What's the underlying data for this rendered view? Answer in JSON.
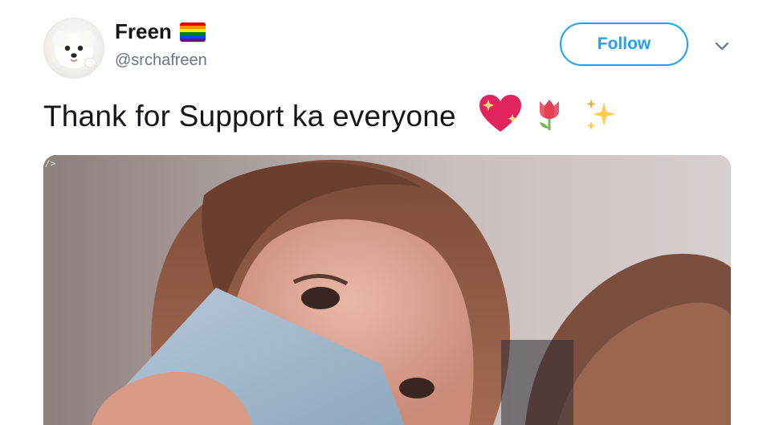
{
  "tweet": {
    "author": {
      "display_name": "Freen",
      "handle": "@srchafreen",
      "avatar_icon": "dog-avatar-icon",
      "badge_icon": "rainbow-flag-icon"
    },
    "follow_label": "Follow",
    "menu_icon": "chevron-down-icon",
    "text": "Thank for Support ka everyone",
    "emojis": [
      "heart-sparkle-icon",
      "tulip-icon",
      "sparkles-icon"
    ],
    "media": {
      "type": "photo",
      "corner_badge": "/>"
    }
  },
  "colors": {
    "accent": "#1da1f2",
    "text": "#14171a",
    "secondary_text": "#657786",
    "flag": [
      "#e40303",
      "#ff8c00",
      "#ffed00",
      "#008026",
      "#004dff",
      "#750787"
    ]
  }
}
